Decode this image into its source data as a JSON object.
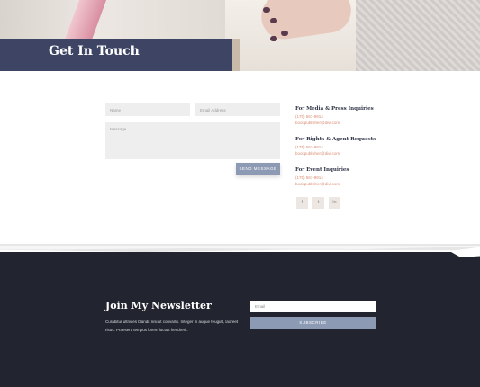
{
  "hero": {
    "title": "Get In Touch"
  },
  "form": {
    "name_placeholder": "Name",
    "email_placeholder": "Email Address",
    "message_placeholder": "Message",
    "send_label": "SEND MESSAGE"
  },
  "inquiries": [
    {
      "title": "For Media & Press Inquiries",
      "phone": "(175) 567-9914",
      "email": "bookpublisher@divi.com"
    },
    {
      "title": "For Rights & Agent Requests",
      "phone": "(175) 567-9914",
      "email": "bookpublisher@divi.com"
    },
    {
      "title": "For Event Inquiries",
      "phone": "(175) 567-9914",
      "email": "bookpublisher@divi.com"
    }
  ],
  "social": [
    "f",
    "t",
    "in"
  ],
  "newsletter": {
    "title": "Join My Newsletter",
    "text": "Curabitur ultricies blandit nisi ut convallis. Integer in augue feugiat, laoreet risus. Praesent tempus lorem luctus hendrerit.",
    "email_placeholder": "Email",
    "subscribe_label": "SUBSCRIBE"
  },
  "colors": {
    "navy": "#3d4464",
    "accent": "#8c9ab4",
    "link": "#d98b72",
    "footer": "#22252f"
  }
}
